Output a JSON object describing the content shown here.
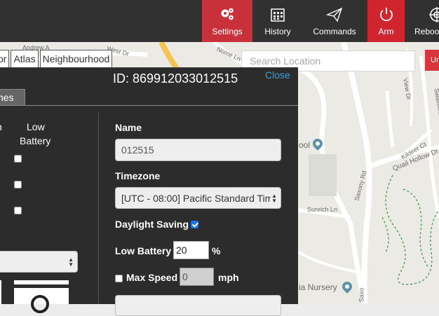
{
  "nav": {
    "items": [
      {
        "label": "Settings",
        "icon": "gears-icon"
      },
      {
        "label": "History",
        "icon": "calendar-icon"
      },
      {
        "label": "Commands",
        "icon": "paper-plane-icon"
      },
      {
        "label": "Arm",
        "icon": "power-icon"
      },
      {
        "label": "Reboo",
        "icon": "crosshair-icon"
      }
    ]
  },
  "layer_tabs": [
    "or",
    "Atlas",
    "Neighbourhood"
  ],
  "search": {
    "placeholder": "Search Location"
  },
  "red_tab": "Ur",
  "map_labels": {
    "roads": [
      "Andrew A",
      "West Dr",
      "Nome Ln",
      "View Dr",
      "Swallowtail Rd",
      "Kildeer Ct",
      "Quail Hollow Dr",
      "Saxony Rd",
      "Sunrich Ln",
      "Saxo"
    ],
    "places": [
      "ool",
      "ia Nursery"
    ]
  },
  "panel": {
    "device_id": "ID: 869912033012515",
    "close": "Close",
    "tab": "nes",
    "left_col": {
      "col_header_cut": "n",
      "low_battery_header": [
        "Low",
        "Battery"
      ]
    },
    "name_label": "Name",
    "name_value": "012515",
    "timezone_label": "Timezone",
    "timezone_value": "[UTC - 08:00] Pacific Standard Time",
    "daylight_label": "Daylight Saving",
    "daylight_checked": true,
    "low_battery_label": "Low Battery",
    "low_battery_value": "20",
    "low_battery_unit": "%",
    "max_speed_label": "Max Speed",
    "max_speed_value": "0",
    "max_speed_unit": "mph",
    "max_speed_checked": false
  },
  "colors": {
    "topbar": "#313131",
    "accent_red": "#d0242e",
    "panel": "#2c2c2c",
    "link": "#3b9fdc"
  }
}
